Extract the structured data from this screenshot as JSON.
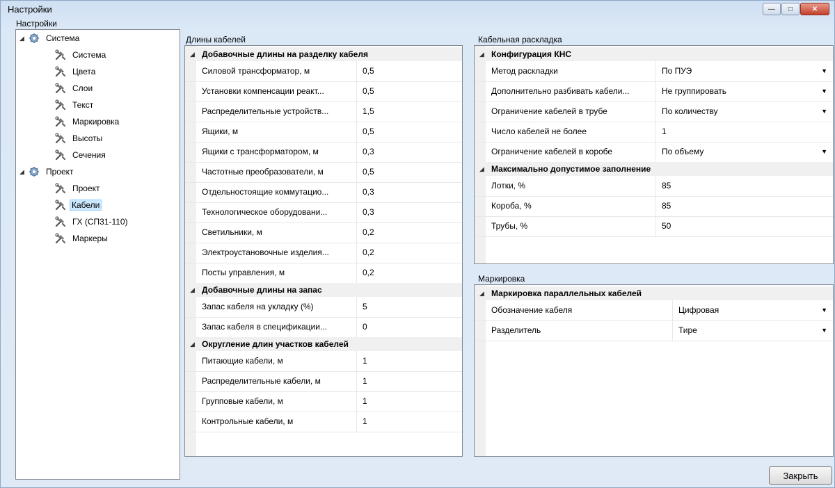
{
  "window": {
    "title": "Настройки"
  },
  "left": {
    "label": "Настройки",
    "tree": [
      {
        "label": "Система",
        "level": 0,
        "type": "root"
      },
      {
        "label": "Система",
        "level": 1
      },
      {
        "label": "Цвета",
        "level": 1
      },
      {
        "label": "Слои",
        "level": 1
      },
      {
        "label": "Текст",
        "level": 1
      },
      {
        "label": "Маркировка",
        "level": 1
      },
      {
        "label": "Высоты",
        "level": 1
      },
      {
        "label": "Сечения",
        "level": 1
      },
      {
        "label": "Проект",
        "level": 0,
        "type": "root"
      },
      {
        "label": "Проект",
        "level": 1
      },
      {
        "label": "Кабели",
        "level": 1,
        "selected": true
      },
      {
        "label": "ГХ (СП31-110)",
        "level": 1
      },
      {
        "label": "Маркеры",
        "level": 1
      }
    ]
  },
  "lengths": {
    "label": "Длины кабелей",
    "groups": [
      {
        "title": "Добавочные длины на разделку кабеля",
        "rows": [
          {
            "name": "Силовой трансформатор, м",
            "value": "0,5"
          },
          {
            "name": "Установки компенсации реакт...",
            "value": "0,5"
          },
          {
            "name": "Распределительные устройств...",
            "value": "1,5"
          },
          {
            "name": "Ящики, м",
            "value": "0,5"
          },
          {
            "name": "Ящики с трансформатором, м",
            "value": "0,3"
          },
          {
            "name": "Частотные преобразователи, м",
            "value": "0,5"
          },
          {
            "name": "Отдельностоящие коммутацио...",
            "value": "0,3"
          },
          {
            "name": "Технологическое оборудовани...",
            "value": "0,3"
          },
          {
            "name": "Светильники, м",
            "value": "0,2"
          },
          {
            "name": "Электроустановочные изделия...",
            "value": "0,2"
          },
          {
            "name": "Посты управления, м",
            "value": "0,2"
          }
        ]
      },
      {
        "title": "Добавочные длины на запас",
        "rows": [
          {
            "name": "Запас кабеля на укладку (%)",
            "value": "5"
          },
          {
            "name": "Запас кабеля в спецификации...",
            "value": "0"
          }
        ]
      },
      {
        "title": "Округление длин участков кабелей",
        "rows": [
          {
            "name": "Питающие кабели, м",
            "value": "1"
          },
          {
            "name": "Распределительные кабели, м",
            "value": "1"
          },
          {
            "name": "Групповые кабели, м",
            "value": "1"
          },
          {
            "name": "Контрольные кабели, м",
            "value": "1"
          }
        ]
      }
    ]
  },
  "layout": {
    "label": "Кабельная раскладка",
    "groups": [
      {
        "title": "Конфигурация КНС",
        "rows": [
          {
            "name": "Метод раскладки",
            "value": "По ПУЭ",
            "dropdown": true
          },
          {
            "name": "Дополнительно разбивать кабели...",
            "value": "Не группировать",
            "dropdown": true
          },
          {
            "name": "Ограничение кабелей в трубе",
            "value": "По количеству",
            "dropdown": true
          },
          {
            "name": "Число кабелей не более",
            "value": "1",
            "dropdown": false
          },
          {
            "name": "Ограничение кабелей в коробе",
            "value": "По объему",
            "dropdown": true
          }
        ]
      },
      {
        "title": "Максимально допустимое заполнение",
        "rows": [
          {
            "name": "Лотки, %",
            "value": "85",
            "dropdown": false
          },
          {
            "name": "Короба, %",
            "value": "85",
            "dropdown": false
          },
          {
            "name": "Трубы, %",
            "value": "50",
            "dropdown": false
          }
        ]
      }
    ]
  },
  "marking": {
    "label": "Маркировка",
    "groups": [
      {
        "title": "Маркировка параллельных кабелей",
        "rows": [
          {
            "name": "Обозначение кабеля",
            "value": "Цифровая",
            "dropdown": true
          },
          {
            "name": "Разделитель",
            "value": "Тире",
            "dropdown": true
          }
        ]
      }
    ]
  },
  "buttons": {
    "close": "Закрыть"
  }
}
